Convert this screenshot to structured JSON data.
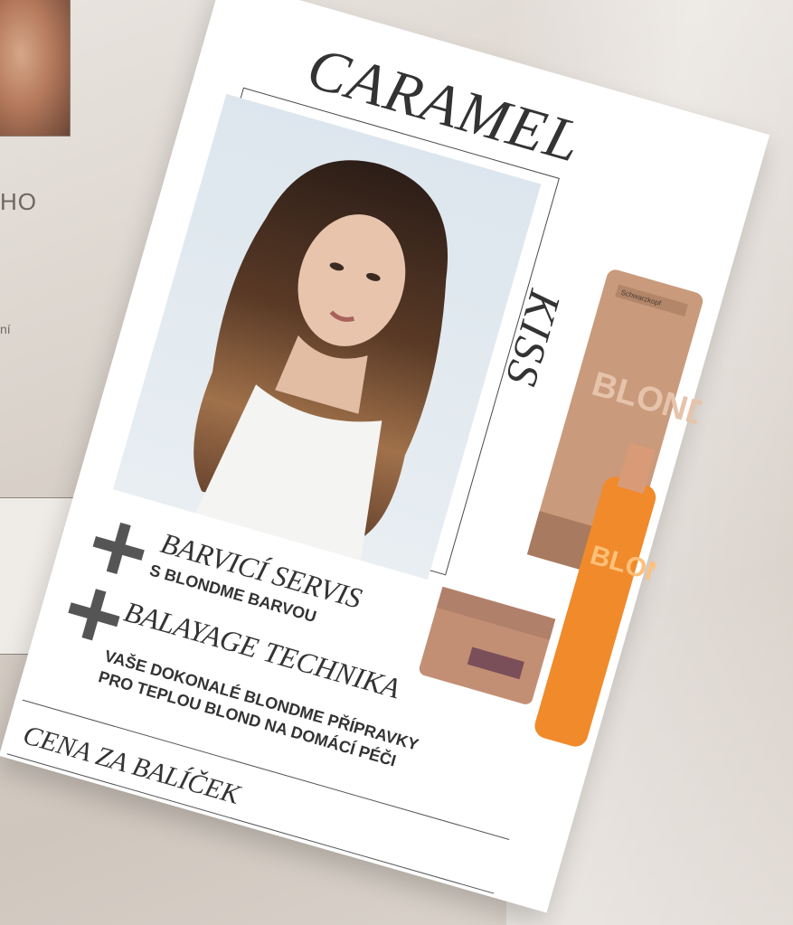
{
  "background": {
    "heading_fragment": "HO",
    "small_fragment": "ní"
  },
  "flyer": {
    "title": "CARAMEL",
    "subtitle": "KISS",
    "services": [
      {
        "title": "BARVICÍ SERVIS",
        "detail": "S BLONDME BARVOU"
      },
      {
        "title": "BALAYAGE TECHNIKA",
        "detail_lines": [
          "VAŠE DOKONALÉ BLONDME PŘÍPRAVKY",
          "PRO TEPLOU BLOND NA DOMÁCÍ PÉČI"
        ]
      }
    ],
    "price_label": "CENA ZA BALÍČEK",
    "product_text": {
      "brand": "Schwarzkopf",
      "tube_letters": "BLOND ME",
      "bottle_letters": "BLOND ME"
    }
  }
}
